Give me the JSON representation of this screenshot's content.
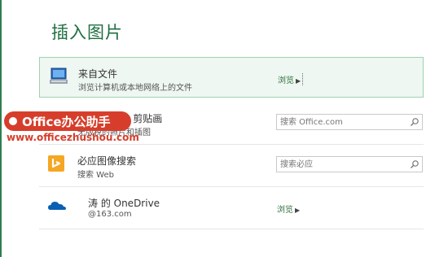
{
  "dialog": {
    "title": "插入图片"
  },
  "rows": [
    {
      "title": "来自文件",
      "subtitle": "浏览计算机或本地网络上的文件",
      "action": "浏览"
    },
    {
      "title": "Office.com 剪贴画",
      "subtitle": "无版税的照片和插图",
      "search_placeholder": "搜索 Office.com"
    },
    {
      "title": "必应图像搜索",
      "subtitle": "搜索 Web",
      "search_placeholder": "搜索必应"
    },
    {
      "title": "涛 的 OneDrive",
      "subtitle": "@163.com",
      "action": "浏览"
    }
  ],
  "watermark": {
    "brand": "Office办公助手",
    "url": "www.officezhushou.com"
  },
  "colors": {
    "accent": "#1f6f3f",
    "selected_bg": "#eef7f1",
    "watermark_red": "#d63e2b",
    "bing": "#f5a623",
    "onedrive": "#0a5fb4"
  },
  "icons": [
    "computer-icon",
    "clipart-icon",
    "bing-icon",
    "onedrive-icon",
    "search-icon",
    "triangle-right-icon"
  ]
}
